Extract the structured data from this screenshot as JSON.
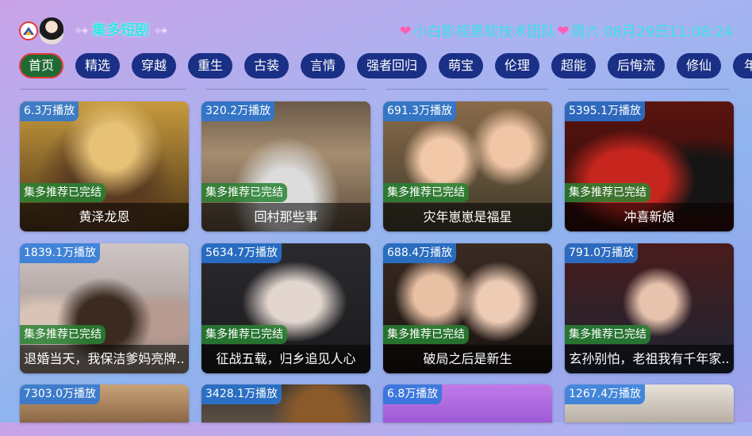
{
  "header": {
    "app_name": "集多短剧",
    "status_text": "小白影视黑软技术团队",
    "datetime": "周六 08月29日11:08:24",
    "heart_icon": "heart-icon",
    "accent_color": "#37e5e5"
  },
  "tabs": [
    {
      "label": "首页",
      "active": true
    },
    {
      "label": "精选"
    },
    {
      "label": "穿越"
    },
    {
      "label": "重生"
    },
    {
      "label": "古装"
    },
    {
      "label": "言情"
    },
    {
      "label": "强者回归"
    },
    {
      "label": "萌宝"
    },
    {
      "label": "伦理"
    },
    {
      "label": "超能"
    },
    {
      "label": "后悔流"
    },
    {
      "label": "修仙"
    },
    {
      "label": "年"
    }
  ],
  "cards": [
    {
      "plays": "6.3万播放",
      "badge": "集多推荐已完结",
      "title": "黄泽龙恩"
    },
    {
      "plays": "320.2万播放",
      "badge": "集多推荐已完结",
      "title": "回村那些事"
    },
    {
      "plays": "691.3万播放",
      "badge": "集多推荐已完结",
      "title": "灾年崽崽是福星"
    },
    {
      "plays": "5395.1万播放",
      "badge": "集多推荐已完结",
      "title": "冲喜新娘"
    },
    {
      "plays": "1839.1万播放",
      "badge": "集多推荐已完结",
      "title": "退婚当天，我保洁爹妈亮牌.."
    },
    {
      "plays": "5634.7万播放",
      "badge": "集多推荐已完结",
      "title": "征战五载，归乡追见人心"
    },
    {
      "plays": "688.4万播放",
      "badge": "集多推荐已完结",
      "title": "破局之后是新生"
    },
    {
      "plays": "791.0万播放",
      "badge": "集多推荐已完结",
      "title": "玄孙别怕，老祖我有千年家.."
    },
    {
      "plays": "7303.0万播放"
    },
    {
      "plays": "3428.1万播放"
    },
    {
      "plays": "6.8万播放"
    },
    {
      "plays": "1267.4万播放"
    }
  ]
}
